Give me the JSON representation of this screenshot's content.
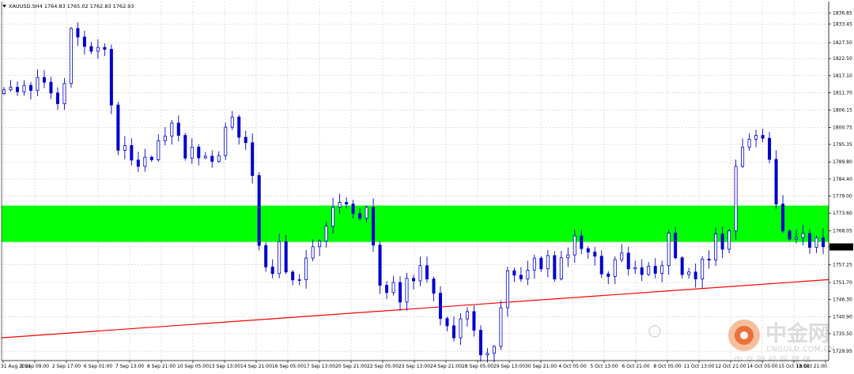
{
  "chart_data": {
    "type": "candlestick",
    "title": "XAUUSD.SH4 1764.83 1765.02 1762.83 1762.93",
    "symbol": "XAUUSD.S",
    "timeframe": "H4",
    "ohlc_display": {
      "open": 1764.83,
      "high": 1765.02,
      "low": 1762.83,
      "close": 1762.93
    },
    "current_price_label": "1762.93",
    "ylim": [
      1727.0,
      1840.5
    ],
    "y_ticks": [
      1836.85,
      1833.45,
      1827.5,
      1822.5,
      1817.1,
      1811.7,
      1806.15,
      1800.75,
      1795.35,
      1789.8,
      1784.4,
      1779.0,
      1773.6,
      1768.05,
      1762.95,
      1757.25,
      1751.7,
      1746.3,
      1740.9,
      1735.5,
      1729.95
    ],
    "x_ticks": [
      "31 Aug 2021",
      "1 Sep 09:00",
      "2 Sep 17:00",
      "6 Sep 01:00",
      "7 Sep 13:00",
      "8 Sep 21:00",
      "10 Sep 05:00",
      "13 Sep 13:00",
      "14 Sep 21:00",
      "16 Sep 05:00",
      "17 Sep 13:00",
      "20 Sep 21:00",
      "22 Sep 05:00",
      "23 Sep 13:00",
      "24 Sep 21:00",
      "28 Sep 05:00",
      "29 Sep 13:00",
      "30 Sep 21:00",
      "4 Oct 05:00",
      "5 Oct 13:00",
      "6 Oct 21:00",
      "8 Oct 05:00",
      "11 Oct 13:00",
      "12 Oct 21:00",
      "14 Oct 05:00",
      "15 Oct 13:00",
      "18 Oct 21:00"
    ],
    "grid": true,
    "zone": {
      "from": 1764.5,
      "to": 1776.0,
      "color": "#00ff00"
    },
    "trendline": {
      "start": 1734.2,
      "end": 1752.6,
      "color": "#ff0000"
    },
    "candle_color": "#0000cc",
    "closes": [
      1812.6,
      1813.4,
      1812.0,
      1814.0,
      1812.4,
      1816.5,
      1815.0,
      1811.6,
      1808.2,
      1814.6,
      1832.0,
      1829.3,
      1826.3,
      1824.8,
      1826.0,
      1825.4,
      1807.8,
      1793.5,
      1795.0,
      1790.4,
      1788.4,
      1791.3,
      1790.5,
      1796.5,
      1798.0,
      1802.1,
      1798.2,
      1791.0,
      1794.5,
      1791.1,
      1791.6,
      1790.0,
      1791.8,
      1800.8,
      1804.0,
      1797.6,
      1795.9,
      1785.5,
      1763.4,
      1756.6,
      1754.5,
      1764.6,
      1755.0,
      1752.5,
      1752.6,
      1759.4,
      1763.0,
      1764.8,
      1769.5,
      1775.5,
      1777.0,
      1776.5,
      1773.5,
      1772.0,
      1775.5,
      1763.5,
      1750.8,
      1748.5,
      1751.7,
      1745.5,
      1753.0,
      1752.2,
      1757.0,
      1752.8,
      1748.3,
      1740.3,
      1738.0,
      1734.2,
      1740.2,
      1742.5,
      1736.6,
      1728.8,
      1729.3,
      1731.5,
      1743.7,
      1755.4,
      1754.0,
      1752.8,
      1755.6,
      1759.4,
      1756.0,
      1760.2,
      1752.8,
      1759.5,
      1760.4,
      1766.4,
      1762.4,
      1761.3,
      1760.0,
      1754.4,
      1753.6,
      1758.9,
      1761.0,
      1756.0,
      1756.4,
      1754.2,
      1756.8,
      1754.6,
      1757.0,
      1767.3,
      1759.5,
      1754.2,
      1755.0,
      1752.8,
      1759.1,
      1758.8,
      1767.0,
      1762.2,
      1768.0,
      1788.4,
      1794.4,
      1797.0,
      1798.2,
      1797.3,
      1790.6,
      1776.5,
      1768.0,
      1765.4,
      1765.9,
      1767.2,
      1762.8,
      1765.8,
      1763.0
    ]
  },
  "watermark": {
    "brand": "中金网",
    "slogan": "中 文 财 经 新 媒 体",
    "site": "CNGOLD.COM.CN"
  }
}
